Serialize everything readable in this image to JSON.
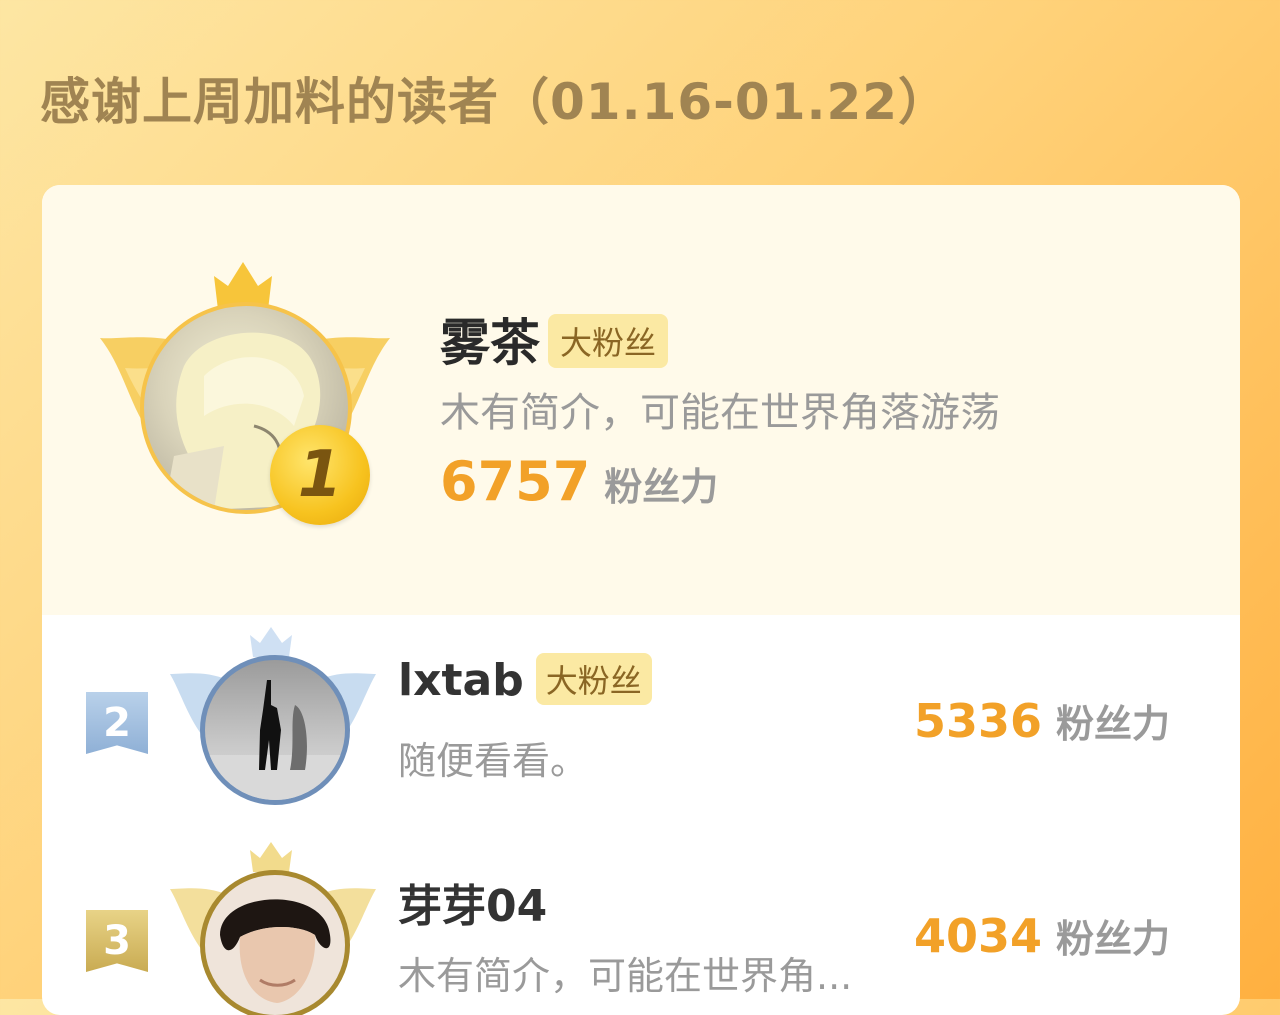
{
  "title": "感谢上周加料的读者（01.16-01.22）",
  "colors": {
    "accent": "#f2a128",
    "tag_bg": "#fbe9a3",
    "tag_text": "#8a6624",
    "title": "#a08452"
  },
  "fan_tag": "大粉丝",
  "unit": "粉丝力",
  "readers": [
    {
      "rank": "1",
      "name": "雾茶",
      "tag": "大粉丝",
      "desc": "木有简介，可能在世界角落游荡",
      "score": "6757",
      "unit": "粉丝力"
    },
    {
      "rank": "2",
      "name": "lxtab",
      "tag": "大粉丝",
      "desc": "随便看看。",
      "score": "5336",
      "unit": "粉丝力"
    },
    {
      "rank": "3",
      "name": "芽芽04",
      "tag": "",
      "desc": "木有简介，可能在世界角...",
      "score": "4034",
      "unit": "粉丝力"
    }
  ]
}
